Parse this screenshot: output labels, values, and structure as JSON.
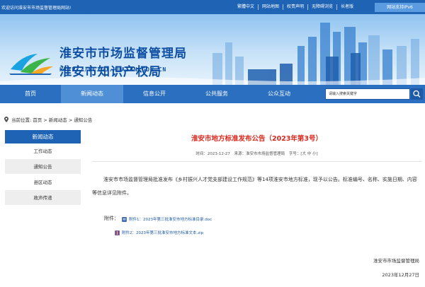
{
  "topbar": {
    "welcome": "欢迎访问淮安市市场监督管理局网站!",
    "links": [
      "繁體中文",
      "网站地图",
      "权责声明",
      "无障碍浏览",
      "长者版"
    ],
    "ipv6": "网站支持IPv6"
  },
  "header": {
    "title_line1": "淮安市市场监督管理局",
    "title_line2": "淮安市知识产权局",
    "domain": "HTTP://SCJGJ.HUAIAN.GOV.CN"
  },
  "nav": {
    "items": [
      "首页",
      "新闻动态",
      "信息公开",
      "公共服务",
      "公众互动"
    ],
    "active_index": 1
  },
  "search": {
    "placeholder": "请输入搜索关键字"
  },
  "breadcrumb": {
    "prefix": "当前位置:",
    "path": "首页 > 新闻动态 > 通知公告"
  },
  "sidebar": {
    "header": "新闻动态",
    "items": [
      "工作动态",
      "通知公告",
      "县区动态",
      "政声传递"
    ]
  },
  "article": {
    "title": "淮安市地方标准发布公告（2023年第3号）",
    "time_label": "时间：2023-12-27",
    "source_label": "来源：淮安市市场监督管理局",
    "font_label": "字号：[大 中 小]",
    "body": "淮安市市场监督管理局批准发布《乡村振兴人才党支部建设工作规范》等14项淮安市地方标准，现予以公告。标准编号、名称、实施日期、内容等信息详见附件。",
    "attachments_label": "附件：",
    "attachments": [
      "附件1：2023年第三批淮安市地方标准目录.doc",
      "附件2：2023年第三批淮安市地方标准文本.zip"
    ],
    "signature": "淮安市市场监督管理局",
    "date": "2023年12月27日"
  },
  "colors": {
    "brand_blue": "#1e63b4",
    "nav_active": "#4f8fd6",
    "title_red": "#d9281d"
  }
}
